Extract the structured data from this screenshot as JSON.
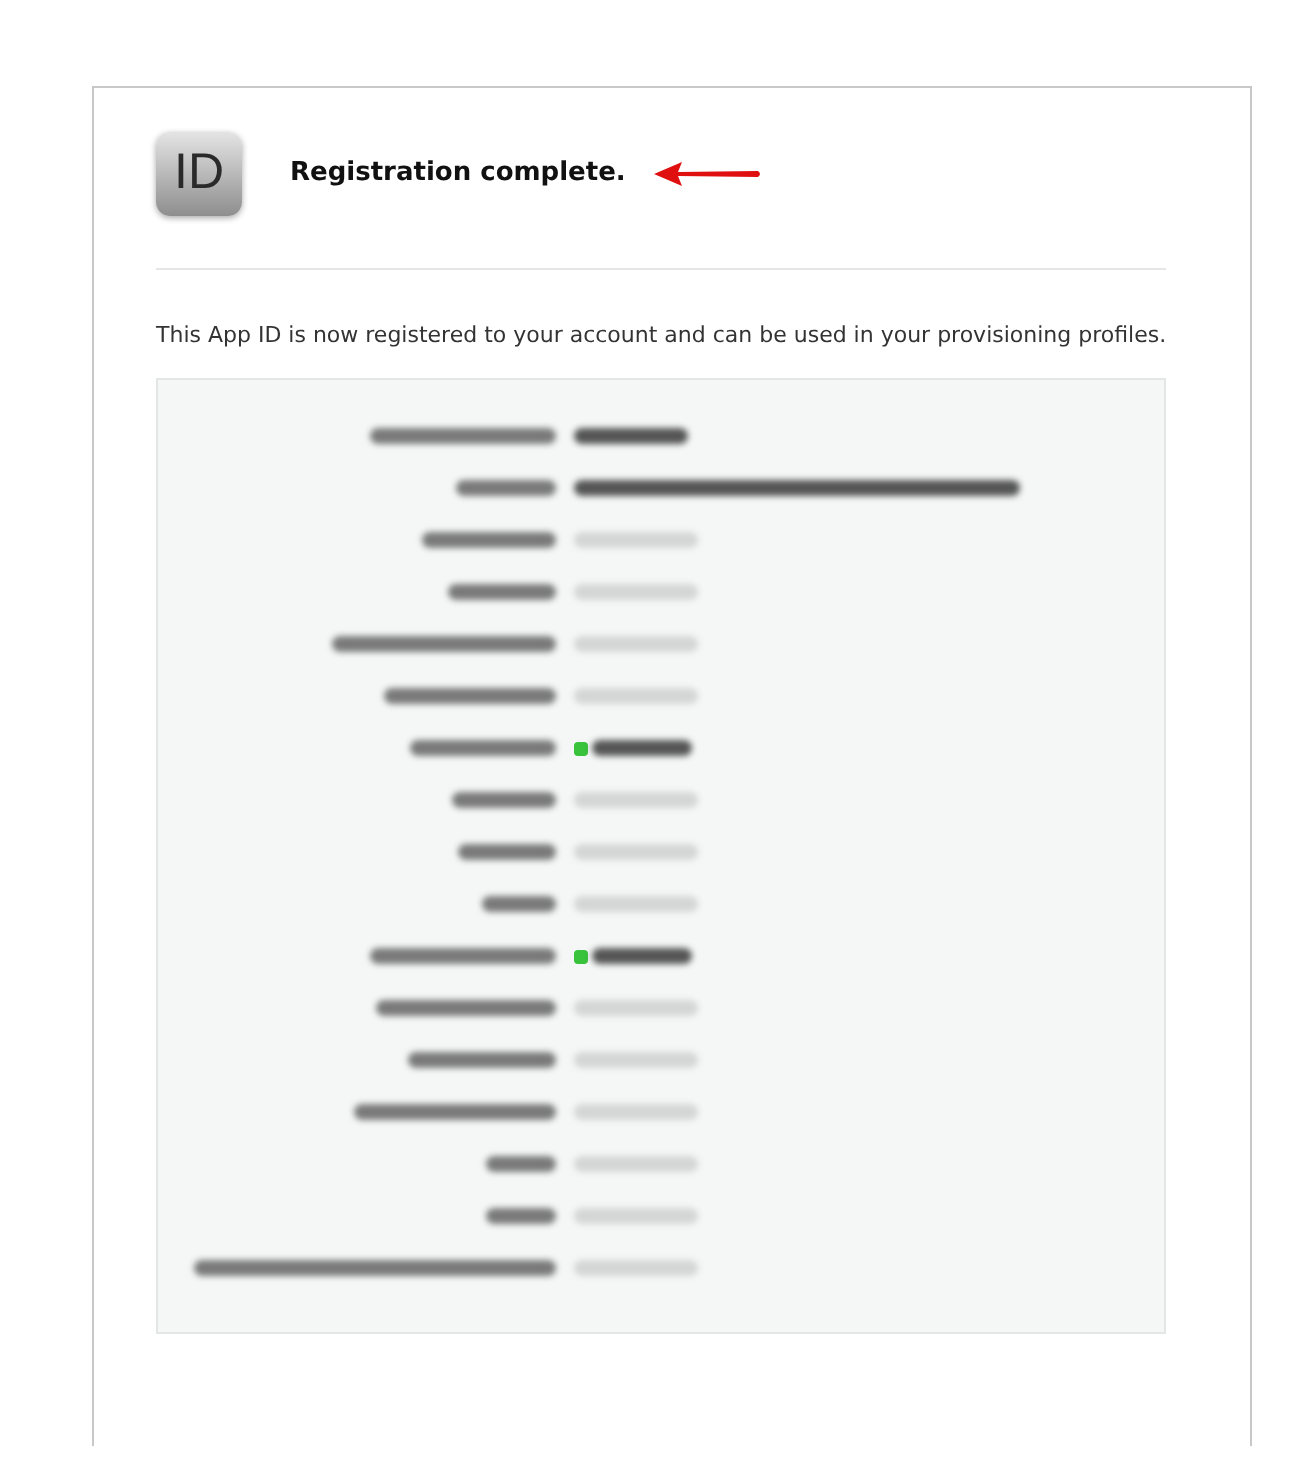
{
  "header": {
    "icon_text": "ID",
    "title": "Registration complete."
  },
  "message": "This App ID is now registered to your account and can be used in your provisioning profiles.",
  "details": [
    {
      "kind": "text"
    },
    {
      "kind": "text"
    },
    {
      "kind": "capability",
      "enabled": false
    },
    {
      "kind": "capability",
      "enabled": false
    },
    {
      "kind": "capability",
      "enabled": false
    },
    {
      "kind": "capability",
      "enabled": false
    },
    {
      "kind": "capability",
      "enabled": true
    },
    {
      "kind": "capability",
      "enabled": false
    },
    {
      "kind": "capability",
      "enabled": false
    },
    {
      "kind": "capability",
      "enabled": false
    },
    {
      "kind": "capability",
      "enabled": true
    },
    {
      "kind": "capability",
      "enabled": false
    },
    {
      "kind": "capability",
      "enabled": false
    },
    {
      "kind": "capability",
      "enabled": false
    },
    {
      "kind": "capability",
      "enabled": false
    },
    {
      "kind": "capability",
      "enabled": false
    },
    {
      "kind": "capability",
      "enabled": false
    }
  ]
}
